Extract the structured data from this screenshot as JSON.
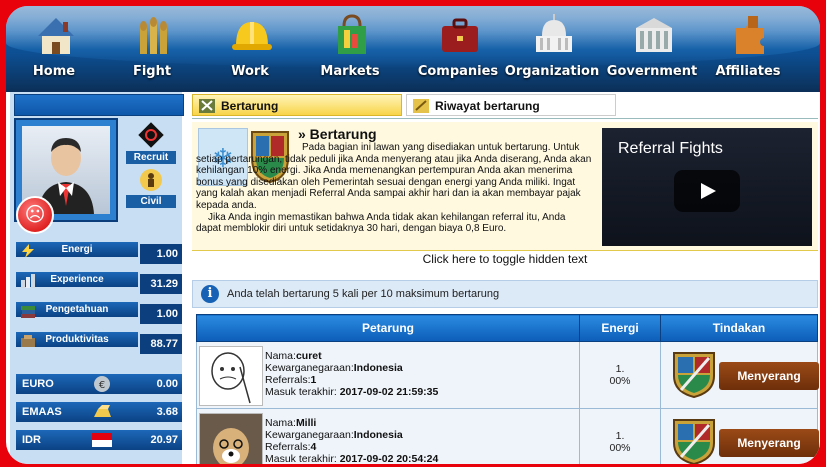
{
  "nav": [
    {
      "key": "home",
      "label": "Home",
      "icon": "house-icon"
    },
    {
      "key": "fight",
      "label": "Fight",
      "icon": "bullets-icon"
    },
    {
      "key": "work",
      "label": "Work",
      "icon": "hardhat-icon"
    },
    {
      "key": "markets",
      "label": "Markets",
      "icon": "shopping-bag-icon"
    },
    {
      "key": "companies",
      "label": "Companies",
      "icon": "briefcase-icon"
    },
    {
      "key": "organization",
      "label": "Organization",
      "icon": "capitol-icon"
    },
    {
      "key": "government",
      "label": "Government",
      "icon": "building-icon"
    },
    {
      "key": "affiliates",
      "label": "Affiliates",
      "icon": "puzzle-icon"
    }
  ],
  "sidebar": {
    "recruit_label": "Recruit",
    "civil_label": "Civil",
    "stats": [
      {
        "name": "Energi",
        "value": "1.00",
        "icon": "energy-icon"
      },
      {
        "name": "Experience",
        "value": "31.29",
        "icon": "experience-icon"
      },
      {
        "name": "Pengetahuan",
        "value": "1.00",
        "icon": "books-icon"
      },
      {
        "name": "Produktivitas",
        "value": "88.77",
        "icon": "productivity-icon"
      }
    ],
    "currencies": [
      {
        "name": "EURO",
        "value": "0.00",
        "icon": "euro-coin-icon"
      },
      {
        "name": "EMAAS",
        "value": "3.68",
        "icon": "gold-icon"
      },
      {
        "name": "IDR",
        "value": "20.97",
        "icon": "indonesia-flag-icon"
      }
    ]
  },
  "tabs": [
    {
      "label": "Bertarung",
      "icon": "fight-tab-icon"
    },
    {
      "label": "Riwayat bertarung",
      "icon": "history-tab-icon"
    }
  ],
  "intro": {
    "title": "» Bertarung",
    "para1": "Pada bagian ini lawan yang disediakan untuk bertarung. Untuk setiap pertarungan, tidak peduli jika Anda menyerang atau jika Anda diserang, Anda akan kehilangan 10% energi. Jika Anda memenangkan pertempuran Anda akan menerima bonus yang disediakan oleh Pemerintah sesuai dengan energi yang Anda miliki. Ingat yang kalah akan menjadi Referral Anda sampai akhir hari dan ia akan membayar pajak kepada anda.",
    "para2": "Jika Anda ingin memastikan bahwa Anda tidak akan kehilangan referral itu, Anda dapat memblokir diri untuk setidaknya 30 hari, dengan biaya 0,8 Euro.",
    "video_title": "Referral Fights"
  },
  "toggle_text": "Click here to toggle hidden text",
  "info_text": "Anda telah bertarung 5 kali per 10 maksimum bertarung",
  "table": {
    "headers": [
      "Petarung",
      "Energi",
      "Tindakan"
    ],
    "rows": [
      {
        "name_label": "Nama:",
        "name": "curet",
        "citizen_label": "Kewarganegaraan:",
        "citizenship": "Indonesia",
        "referrals_label": "Referrals:",
        "referrals": "1",
        "last_login_label": "Masuk terakhir: ",
        "last_login": "2017-09-02 21:59:35",
        "energy_line1": "1.",
        "energy_line2": "00%",
        "action_label": "Menyerang"
      },
      {
        "name_label": "Nama:",
        "name": "Milli",
        "citizen_label": "Kewarganegaraan:",
        "citizenship": "Indonesia",
        "referrals_label": "Referrals:",
        "referrals": "4",
        "last_login_label": "Masuk terakhir: ",
        "last_login": "2017-09-02 20:54:24",
        "energy_line1": "1.",
        "energy_line2": "00%",
        "action_label": "Menyerang"
      }
    ]
  }
}
